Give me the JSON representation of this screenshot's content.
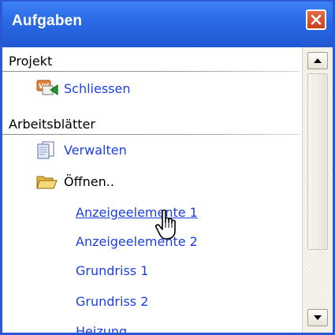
{
  "window": {
    "title": "Aufgaben"
  },
  "sections": [
    {
      "header": "Projekt",
      "items": [
        {
          "label": "Schliessen",
          "icon": "close-project-icon"
        }
      ]
    },
    {
      "header": "Arbeitsblätter",
      "items": [
        {
          "label": "Verwalten",
          "icon": "worksheets-icon"
        },
        {
          "label": "Öffnen..",
          "icon": "open-folder-icon"
        },
        {
          "label": "Anzeigeelemente 1"
        },
        {
          "label": "Anzeigeelemente 2"
        },
        {
          "label": "Grundriss 1"
        },
        {
          "label": "Grundriss 2"
        },
        {
          "label": "Heizung"
        }
      ]
    }
  ],
  "cursor": "hand-pointer-icon",
  "colors": {
    "titlebar": "#2a6be6",
    "link": "#1c3fe0",
    "close_button": "#d5512d"
  }
}
